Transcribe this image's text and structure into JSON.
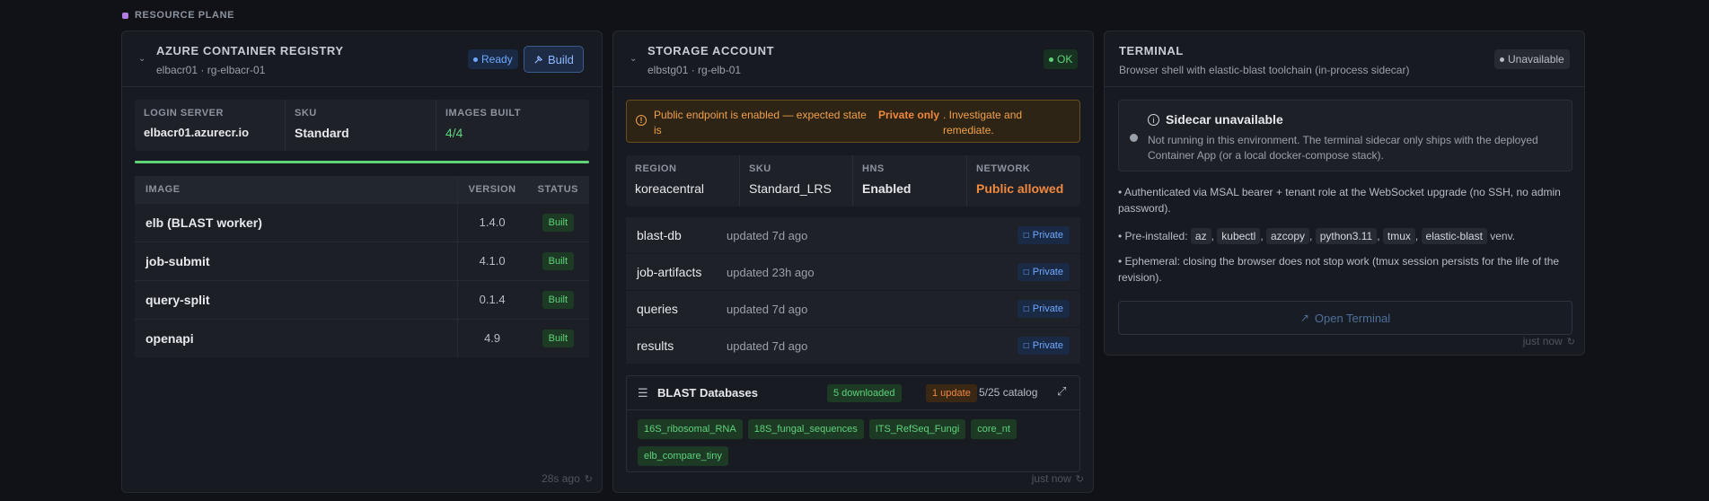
{
  "section": {
    "label": "RESOURCE PLANE"
  },
  "acr": {
    "title": "AZURE CONTAINER REGISTRY",
    "subtitle": "elbacr01 · rg-elbacr-01",
    "status": "Ready",
    "build_label": "Build",
    "stats": [
      {
        "label": "LOGIN SERVER",
        "value": "elbacr01.azurecr.io"
      },
      {
        "label": "SKU",
        "value": "Standard"
      },
      {
        "label": "IMAGES BUILT",
        "value": "4/4"
      }
    ],
    "build_progress": 1.0,
    "table": {
      "headers": [
        "IMAGE",
        "VERSION",
        "STATUS"
      ],
      "rows": [
        {
          "image": "elb (BLAST worker)",
          "version": "1.4.0",
          "status": "Built"
        },
        {
          "image": "job-submit",
          "version": "4.1.0",
          "status": "Built"
        },
        {
          "image": "query-split",
          "version": "0.1.4",
          "status": "Built"
        },
        {
          "image": "openapi",
          "version": "4.9",
          "status": "Built"
        }
      ]
    },
    "footer": "28s ago"
  },
  "storage": {
    "title": "STORAGE ACCOUNT",
    "subtitle": "elbstg01 · rg-elb-01",
    "status": "OK",
    "warning": {
      "text1": "Public endpoint is enabled — expected state is",
      "strong": "Private only",
      "text2": ". Investigate and remediate."
    },
    "stats": [
      {
        "label": "REGION",
        "value": "koreacentral"
      },
      {
        "label": "SKU",
        "value": "Standard_LRS"
      },
      {
        "label": "HNS",
        "value": "Enabled"
      },
      {
        "label": "NETWORK",
        "value": "Public allowed"
      }
    ],
    "containers": [
      {
        "name": "blast-db",
        "updated": "updated 7d ago",
        "access": "Private"
      },
      {
        "name": "job-artifacts",
        "updated": "updated 23h ago",
        "access": "Private"
      },
      {
        "name": "queries",
        "updated": "updated 7d ago",
        "access": "Private"
      },
      {
        "name": "results",
        "updated": "updated 7d ago",
        "access": "Private"
      }
    ],
    "blast_db": {
      "title": "BLAST Databases",
      "downloaded": "5 downloaded",
      "update": "1 update",
      "catalog": "5/25 catalog",
      "databases": [
        "16S_ribosomal_RNA",
        "18S_fungal_sequences",
        "ITS_RefSeq_Fungi",
        "core_nt",
        "elb_compare_tiny"
      ]
    },
    "footer": "just now"
  },
  "terminal": {
    "title": "TERMINAL",
    "subtitle": "Browser shell with elastic-blast toolchain (in-process sidecar)",
    "status": "Unavailable",
    "sidecar": {
      "title": "Sidecar unavailable",
      "text": "Not running in this environment. The terminal sidecar only ships with the deployed Container App (or a local docker-compose stack)."
    },
    "notes": {
      "auth": "• Authenticated via MSAL bearer + tenant role at the WebSocket upgrade (no SSH, no admin password).",
      "preinstalled_prefix": "• Pre-installed:",
      "preinstalled_tools": [
        "az",
        "kubectl",
        "azcopy",
        "python3.11",
        "tmux",
        "elastic-blast"
      ],
      "preinstalled_suffix": "venv.",
      "ephemeral": "• Ephemeral: closing the browser does not stop work (tmux session persists for the life of the revision)."
    },
    "open_label": "Open Terminal",
    "footer": "just now"
  },
  "colors": {
    "accent": "#6ea8ff",
    "success": "#5fd27a",
    "warning": "#f0883e",
    "section_dot": "#b07ce0"
  }
}
